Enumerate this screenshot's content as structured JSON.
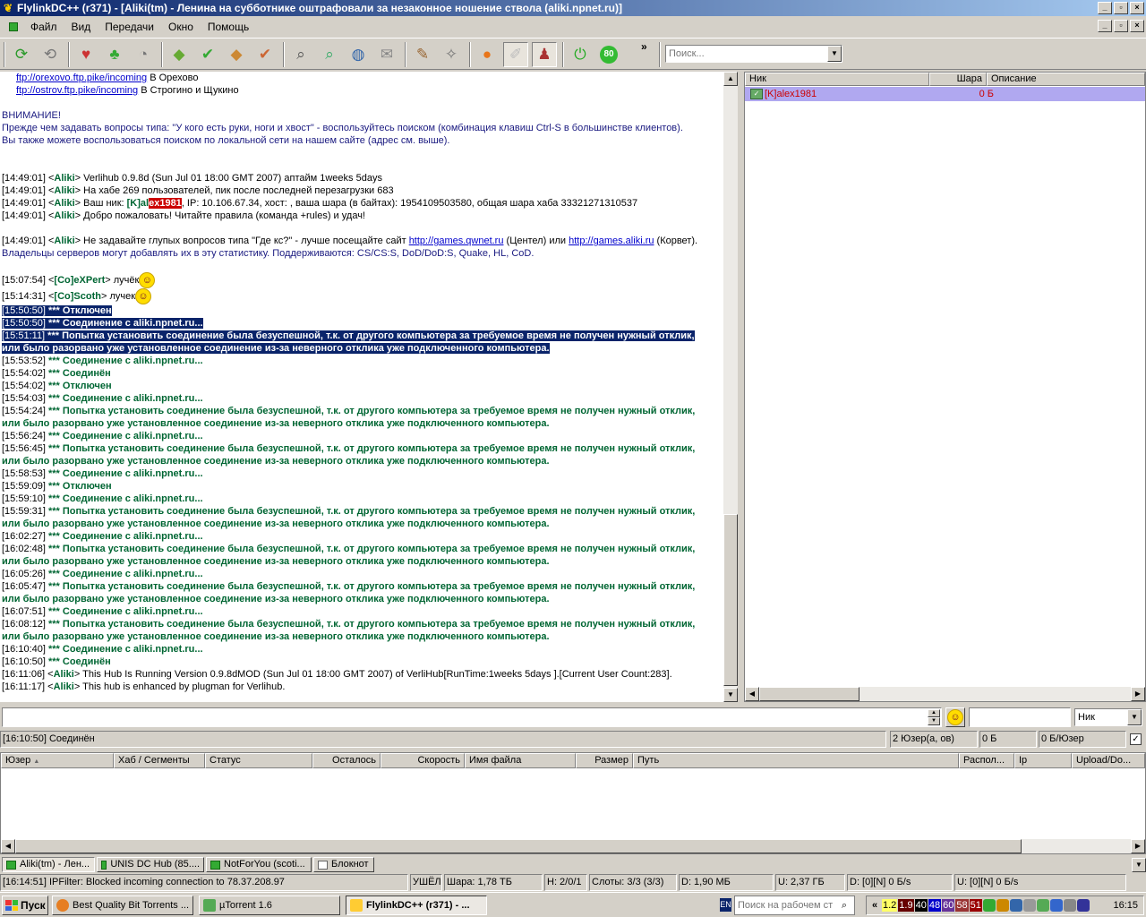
{
  "window": {
    "title": "FlylinkDC++ (r371) - [Aliki(tm) -  Ленина на субботнике оштрафовали за незаконное ношение ствола (aliki.npnet.ru)]"
  },
  "menu": [
    "Файл",
    "Вид",
    "Передачи",
    "Окно",
    "Помощь"
  ],
  "toolbar": {
    "more": "»",
    "search_placeholder": "Поиск...",
    "limit_badge": "80"
  },
  "chat_lines": [
    {
      "kind": "linkline",
      "link": "ftp://orexovo.ftp.pike/incoming",
      "text": "    В Орехово"
    },
    {
      "kind": "linkline",
      "link": "ftp://ostrov.ftp.pike/incoming",
      "text": "    В Строгино и Щукино"
    },
    {
      "kind": "blank"
    },
    {
      "kind": "plain",
      "text": "ВНИМАНИЕ!"
    },
    {
      "kind": "plain",
      "text": "  Прежде чем задавать вопросы типа: \"У кого есть руки, ноги и хвост\" - воспользуйтесь поиском (комбинация клавиш Ctrl-S в большинстве клиентов)."
    },
    {
      "kind": "plain",
      "text": "  Вы также можете воспользоваться поиском по локальной сети на нашем сайте (адрес см. выше)."
    },
    {
      "kind": "blank"
    },
    {
      "kind": "blank"
    },
    {
      "kind": "msg",
      "time": "[14:49:01]",
      "nick": "Aliki",
      "text": " Verlihub 0.9.8d (Sun Jul 01 18:00 GMT 2007) аптайм 1weeks 5days"
    },
    {
      "kind": "msg",
      "time": "[14:49:01]",
      "nick": "Aliki",
      "text": " На хабе 269 пользователей, пик после последней перезагрузки 683"
    },
    {
      "kind": "mynick",
      "time": "[14:49:01]",
      "nick": "Aliki",
      "pre": " Ваш ник: ",
      "nick_a": "[K]al",
      "nick_b": "ex1981",
      "text": ", IP: 10.106.67.34, хост: , ваша шара (в байтах): 1954109503580, общая шара хаба 33321271310537"
    },
    {
      "kind": "msg",
      "time": "[14:49:01]",
      "nick": "Aliki",
      "text": " Добро пожаловать! Читайте правила (команда +rules) и удач!"
    },
    {
      "kind": "blank"
    },
    {
      "kind": "links",
      "time": "[14:49:01]",
      "nick": "Aliki",
      "pre": " Не задавайте глупых вопросов типа \"Где кс?\" - лучше посещайте сайт ",
      "l1": "http://games.qwnet.ru",
      "mid": " (Центел) или ",
      "l2": "http://games.aliki.ru",
      "post": " (Корвет)."
    },
    {
      "kind": "plain",
      "text": "Владельцы серверов могут добавлять их в эту статистику. Поддерживаются: CS/CS:S, DoD/DoD:S, Quake, HL, CoD."
    },
    {
      "kind": "blank"
    },
    {
      "kind": "smile",
      "time": "[15:07:54]",
      "nick": "[Co]eXPert",
      "text": " лучёк"
    },
    {
      "kind": "smile",
      "time": "[15:14:31]",
      "nick": "[Co]Scoth",
      "text": " лучек"
    },
    {
      "kind": "sys",
      "sel": true,
      "time": "[15:50:50]",
      "text": " *** Отключен"
    },
    {
      "kind": "sys",
      "sel": true,
      "time": "[15:50:50]",
      "text": " *** Соединение с aliki.npnet.ru..."
    },
    {
      "kind": "sys",
      "sel": true,
      "time": "[15:51:11]",
      "text": " *** Попытка установить соединение была безуспешной, т.к. от другого компьютера за требуемое время не получен нужный отклик,"
    },
    {
      "kind": "syscont",
      "sel": true,
      "text": "или было разорвано уже установленное соединение из-за неверного отклика уже подключенного компьютера."
    },
    {
      "kind": "sys",
      "time": "[15:53:52]",
      "text": " *** Соединение с aliki.npnet.ru..."
    },
    {
      "kind": "sys",
      "time": "[15:54:02]",
      "text": " *** Соединён"
    },
    {
      "kind": "sys",
      "time": "[15:54:02]",
      "text": " *** Отключен"
    },
    {
      "kind": "sys",
      "time": "[15:54:03]",
      "text": " *** Соединение с aliki.npnet.ru..."
    },
    {
      "kind": "sys",
      "time": "[15:54:24]",
      "text": " *** Попытка установить соединение была безуспешной, т.к. от другого компьютера за требуемое время не получен нужный отклик,"
    },
    {
      "kind": "syscont",
      "text": "или было разорвано уже установленное соединение из-за неверного отклика уже подключенного компьютера."
    },
    {
      "kind": "sys",
      "time": "[15:56:24]",
      "text": " *** Соединение с aliki.npnet.ru..."
    },
    {
      "kind": "sys",
      "time": "[15:56:45]",
      "text": " *** Попытка установить соединение была безуспешной, т.к. от другого компьютера за требуемое время не получен нужный отклик,"
    },
    {
      "kind": "syscont",
      "text": "или было разорвано уже установленное соединение из-за неверного отклика уже подключенного компьютера."
    },
    {
      "kind": "sys",
      "time": "[15:58:53]",
      "text": " *** Соединение с aliki.npnet.ru..."
    },
    {
      "kind": "sys",
      "time": "[15:59:09]",
      "text": " *** Отключен"
    },
    {
      "kind": "sys",
      "time": "[15:59:10]",
      "text": " *** Соединение с aliki.npnet.ru..."
    },
    {
      "kind": "sys",
      "time": "[15:59:31]",
      "text": " *** Попытка установить соединение была безуспешной, т.к. от другого компьютера за требуемое время не получен нужный отклик,"
    },
    {
      "kind": "syscont",
      "text": "или было разорвано уже установленное соединение из-за неверного отклика уже подключенного компьютера."
    },
    {
      "kind": "sys",
      "time": "[16:02:27]",
      "text": " *** Соединение с aliki.npnet.ru..."
    },
    {
      "kind": "sys",
      "time": "[16:02:48]",
      "text": " *** Попытка установить соединение была безуспешной, т.к. от другого компьютера за требуемое время не получен нужный отклик,"
    },
    {
      "kind": "syscont",
      "text": "или было разорвано уже установленное соединение из-за неверного отклика уже подключенного компьютера."
    },
    {
      "kind": "sys",
      "time": "[16:05:26]",
      "text": " *** Соединение с aliki.npnet.ru..."
    },
    {
      "kind": "sys",
      "time": "[16:05:47]",
      "text": " *** Попытка установить соединение была безуспешной, т.к. от другого компьютера за требуемое время не получен нужный отклик,"
    },
    {
      "kind": "syscont",
      "text": "или было разорвано уже установленное соединение из-за неверного отклика уже подключенного компьютера."
    },
    {
      "kind": "sys",
      "time": "[16:07:51]",
      "text": " *** Соединение с aliki.npnet.ru..."
    },
    {
      "kind": "sys",
      "time": "[16:08:12]",
      "text": " *** Попытка установить соединение была безуспешной, т.к. от другого компьютера за требуемое время не получен нужный отклик,"
    },
    {
      "kind": "syscont",
      "text": "или было разорвано уже установленное соединение из-за неверного отклика уже подключенного компьютера."
    },
    {
      "kind": "sys",
      "time": "[16:10:40]",
      "text": " *** Соединение с aliki.npnet.ru..."
    },
    {
      "kind": "sys",
      "time": "[16:10:50]",
      "text": " *** Соединён"
    },
    {
      "kind": "msg",
      "time": "[16:11:06]",
      "nick": "Aliki",
      "text": " This Hub Is Running Version 0.9.8dMOD (Sun Jul 01 18:00 GMT 2007) of VerliHub[RunTime:1weeks 5days ].[Current User Count:283]."
    },
    {
      "kind": "msg",
      "time": "[16:11:17]",
      "nick": "Aliki",
      "text": " This hub is enhanced by plugman for Verlihub."
    }
  ],
  "users": {
    "columns": [
      "Ник",
      "Шара",
      "Описание"
    ],
    "rows": [
      {
        "nick": "[K]alex1981",
        "share": "0 Б",
        "desc": ""
      }
    ]
  },
  "input": {
    "message": "",
    "filter": "",
    "filter_field": "Ник"
  },
  "hub_status": {
    "last": "[16:10:50] Соединён",
    "users": "2 Юзер(а, ов)",
    "share": "0 Б",
    "per_user": "0 Б/Юзер"
  },
  "transfers": {
    "columns": [
      "Юзер",
      "Хаб / Сегменты",
      "Статус",
      "Осталось",
      "Скорость",
      "Имя файла",
      "Размер",
      "Путь",
      "Распол...",
      "Ip",
      "Upload/Do..."
    ]
  },
  "tabs": [
    "Aliki(tm) - Лен...",
    "UNIS DC Hub (85....",
    "NotForYou (scoti...",
    "Блокнот"
  ],
  "statusbar": [
    "[16:14:51] IPFilter: Blocked incoming connection to 78.37.208.97",
    "УШЁЛ",
    "Шара: 1,78 ТБ",
    "Н: 2/0/1",
    "Слоты: 3/3 (3/3)",
    "D: 1,90 МБ",
    "U: 2,37 ГБ",
    "D: [0][N] 0 Б/s",
    "U: [0][N] 0 Б/s"
  ],
  "taskbar": {
    "start": "Пуск",
    "tasks": [
      "Best Quality Bit Torrents ...",
      "µTorrent 1.6",
      "FlylinkDC++ (r371) - ..."
    ],
    "lang": "EN",
    "desk_search_placeholder": "Поиск на рабочем ст",
    "tray_values": [
      "«",
      "1.2",
      "1.9",
      "40",
      "48",
      "60",
      "58",
      "51"
    ],
    "clock": "16:15"
  }
}
